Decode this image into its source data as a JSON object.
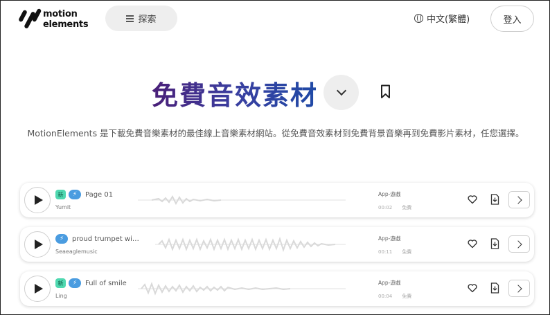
{
  "header": {
    "logo_line1": "motion",
    "logo_line2": "elements",
    "search_label": "探索",
    "language_label": "中文(繁體)",
    "login_label": "登入"
  },
  "hero": {
    "title": "免費音效素材",
    "description": "MotionElements 是下載免費音樂素材的最佳線上音樂素材網站。從免費音效素材到免費背景音樂再到免費影片素材，任您選擇。"
  },
  "tracks": [
    {
      "badge_new": "新",
      "title": "Page 01",
      "author": "Yumit",
      "category": "App‑遊戲",
      "duration": "00:02",
      "price": "免費",
      "has_new": true
    },
    {
      "badge_new": "",
      "title": "proud trumpet wi…",
      "author": "Seaeaglemusic",
      "category": "App‑遊戲",
      "duration": "00:11",
      "price": "免費",
      "has_new": false
    },
    {
      "badge_new": "新",
      "title": "Full of smile",
      "author": "Ling",
      "category": "App‑遊戲",
      "duration": "00:04",
      "price": "免費",
      "has_new": true
    }
  ],
  "icons": {
    "play": "play-icon",
    "bolt": "bolt-icon",
    "heart": "heart-icon",
    "download": "download-icon",
    "chevron": "chevron-right-icon"
  },
  "colors": {
    "new_badge": "#4fd8b0",
    "bolt_badge": "#4a9ce0",
    "title_gradient_start": "#4a1f78",
    "title_gradient_end": "#1f4aa6"
  }
}
